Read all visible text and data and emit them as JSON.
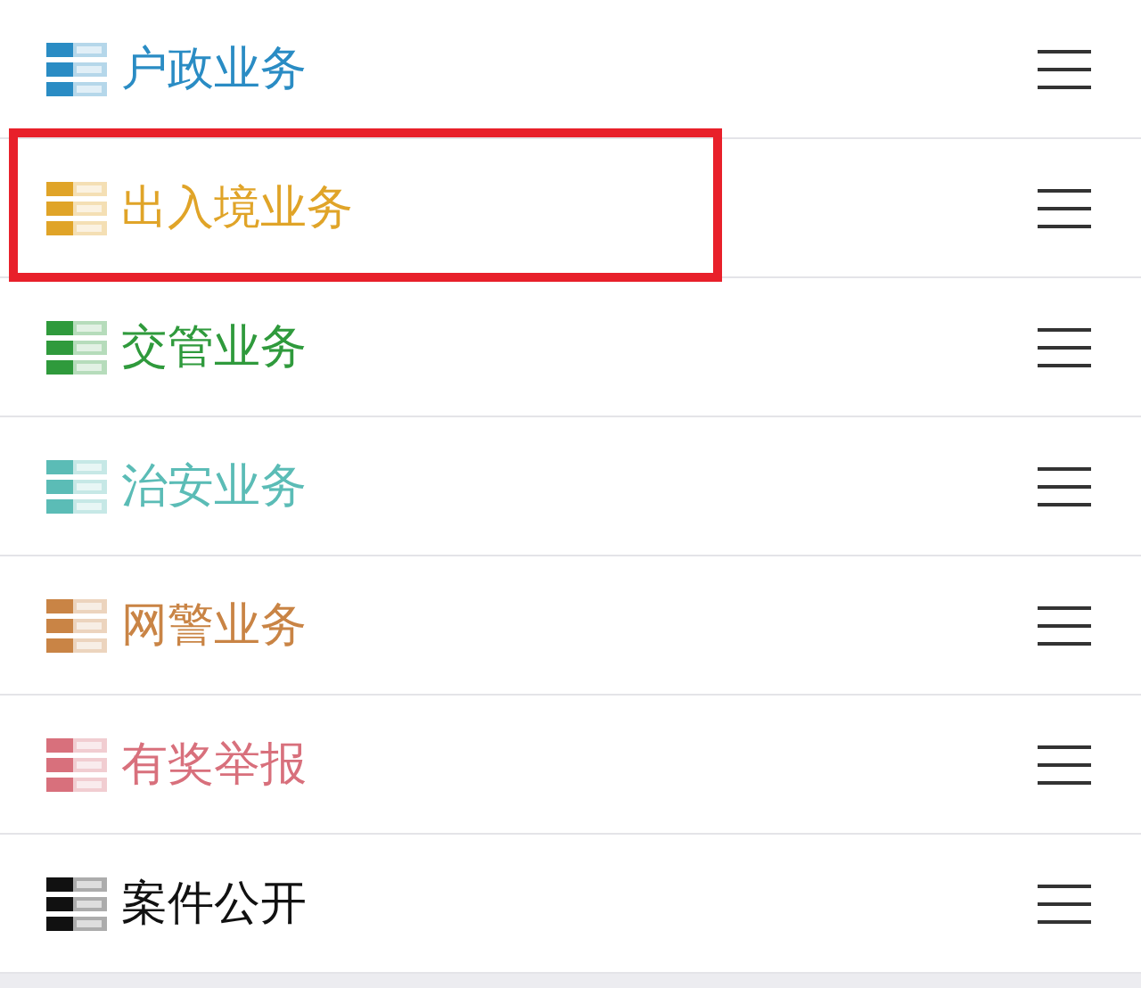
{
  "menu_items": [
    {
      "label": "户政业务",
      "color": "#2a8cc4",
      "selected": false
    },
    {
      "label": "出入境业务",
      "color": "#e0a428",
      "selected": true
    },
    {
      "label": "交管业务",
      "color": "#2f9a3c",
      "selected": false
    },
    {
      "label": "治安业务",
      "color": "#5bbcb6",
      "selected": false
    },
    {
      "label": "网警业务",
      "color": "#c98445",
      "selected": false
    },
    {
      "label": "有奖举报",
      "color": "#d8707c",
      "selected": false
    },
    {
      "label": "案件公开",
      "color": "#111111",
      "selected": false
    }
  ]
}
